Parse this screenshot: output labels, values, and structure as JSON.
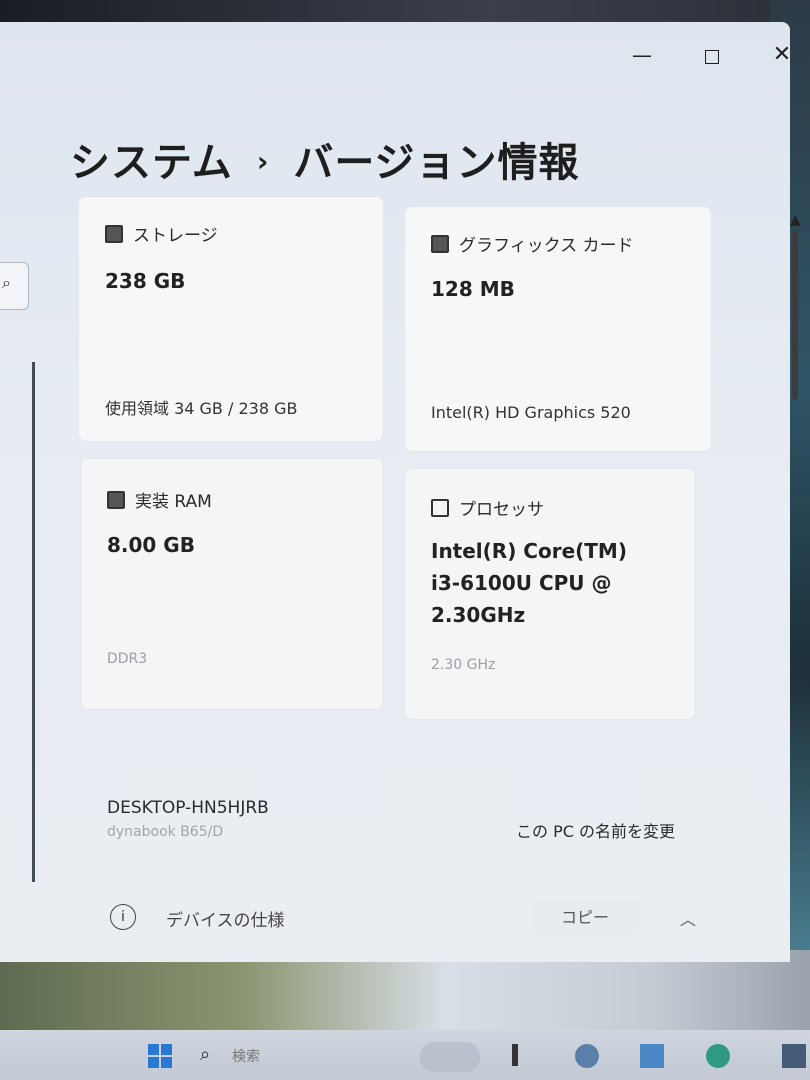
{
  "window": {
    "minimize_icon": "minimize-icon",
    "maximize_icon": "maximize-icon",
    "close_glyph": "✕"
  },
  "breadcrumb": {
    "parent": "システム",
    "separator": "›",
    "current": "バージョン情報"
  },
  "cards": {
    "storage": {
      "icon": "storage-icon",
      "title": "ストレージ",
      "value": "238 GB",
      "detail": "使用領域 34 GB / 238 GB"
    },
    "graphics": {
      "icon": "graphics-card-icon",
      "title": "グラフィックス カード",
      "value": "128 MB",
      "detail": "Intel(R) HD Graphics 520"
    },
    "ram": {
      "icon": "memory-icon",
      "title": "実装 RAM",
      "value": "8.00 GB",
      "detail": "DDR3"
    },
    "processor": {
      "icon": "processor-icon",
      "title": "プロセッサ",
      "value": "Intel(R) Core(TM)\ni3-6100U CPU @\n2.30GHz",
      "detail": "2.30 GHz"
    }
  },
  "device": {
    "name": "DESKTOP-HN5HJRB",
    "model": "dynabook B65/D",
    "rename_link": "この PC の名前を変更"
  },
  "device_spec": {
    "info_glyph": "i",
    "label": "デバイスの仕様",
    "copy_button": "コピー",
    "chevron": "︿"
  },
  "taskbar": {
    "search_placeholder": "検索"
  }
}
